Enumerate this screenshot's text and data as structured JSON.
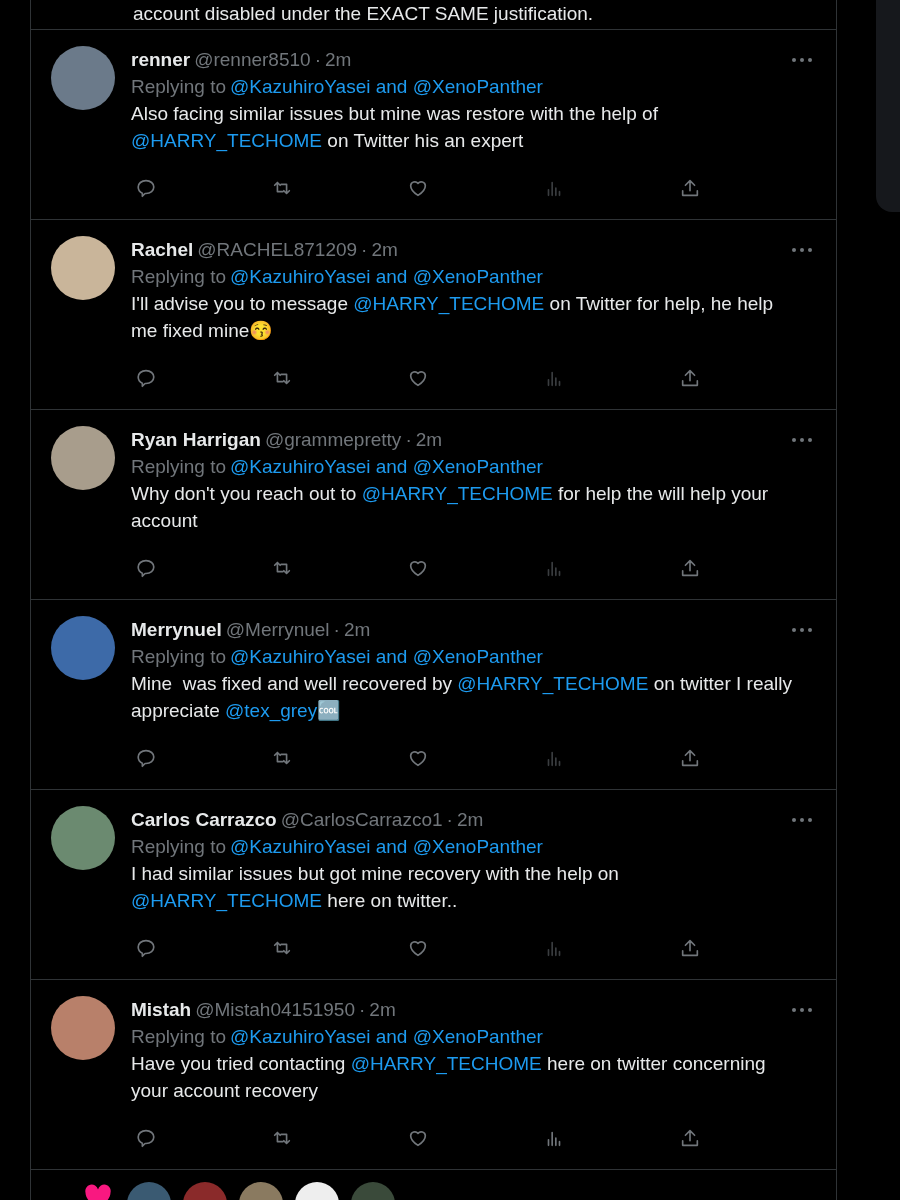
{
  "previous_tweet": {
    "text_fragment": "account disabled under the EXACT SAME justification."
  },
  "replies": [
    {
      "name": "renner",
      "handle": "@renner8510",
      "separator": "·",
      "time": "2m",
      "replying_label": "Replying to",
      "replying_to": "@KazuhiroYasei and @XenoPanther",
      "analytics_dim": true,
      "body": [
        {
          "kind": "text",
          "text": "Also facing similar issues but mine was restore with the help of "
        },
        {
          "kind": "mention",
          "text": "@HARRY_TECHOME"
        },
        {
          "kind": "text",
          "text": " on Twitter his an expert"
        }
      ]
    },
    {
      "name": "Rachel",
      "handle": "@RACHEL871209",
      "separator": "·",
      "time": "2m",
      "replying_label": "Replying to",
      "replying_to": "@KazuhiroYasei and @XenoPanther",
      "analytics_dim": true,
      "body": [
        {
          "kind": "text",
          "text": "I'll advise you to message "
        },
        {
          "kind": "mention",
          "text": "@HARRY_TECHOME"
        },
        {
          "kind": "text",
          "text": " on Twitter for help, he help me fixed mine😚"
        }
      ]
    },
    {
      "name": "Ryan Harrigan",
      "handle": "@grammepretty",
      "separator": "·",
      "time": "2m",
      "replying_label": "Replying to",
      "replying_to": "@KazuhiroYasei and @XenoPanther",
      "analytics_dim": true,
      "body": [
        {
          "kind": "text",
          "text": "Why don't you reach out to "
        },
        {
          "kind": "mention",
          "text": "@HARRY_TECHOME"
        },
        {
          "kind": "text",
          "text": " for help the will help your account"
        }
      ]
    },
    {
      "name": "Merrynuel",
      "handle": "@Merrynuel",
      "separator": "·",
      "time": "2m",
      "replying_label": "Replying to",
      "replying_to": "@KazuhiroYasei and @XenoPanther",
      "analytics_dim": true,
      "body": [
        {
          "kind": "text",
          "text": "Mine  was fixed and well recovered by "
        },
        {
          "kind": "mention",
          "text": "@HARRY_TECHOME"
        },
        {
          "kind": "text",
          "text": " on twitter I really appreciate "
        },
        {
          "kind": "mention",
          "text": "@tex_grey"
        },
        {
          "kind": "text",
          "text": "🆒"
        }
      ]
    },
    {
      "name": "Carlos Carrazco",
      "handle": "@CarlosCarrazco1",
      "separator": "·",
      "time": "2m",
      "replying_label": "Replying to",
      "replying_to": "@KazuhiroYasei and @XenoPanther",
      "analytics_dim": true,
      "body": [
        {
          "kind": "text",
          "text": "I had similar issues but got mine recovery with the help on "
        },
        {
          "kind": "mention",
          "text": "@HARRY_TECHOME"
        },
        {
          "kind": "text",
          "text": " here on twitter.."
        }
      ]
    },
    {
      "name": "Mistah",
      "handle": "@Mistah04151950",
      "separator": "·",
      "time": "2m",
      "replying_label": "Replying to",
      "replying_to": "@KazuhiroYasei and @XenoPanther",
      "analytics_dim": false,
      "body": [
        {
          "kind": "text",
          "text": "Have you tried contacting "
        },
        {
          "kind": "mention",
          "text": "@HARRY_TECHOME"
        },
        {
          "kind": "text",
          "text": " here on twitter concerning your account recovery"
        }
      ]
    }
  ]
}
